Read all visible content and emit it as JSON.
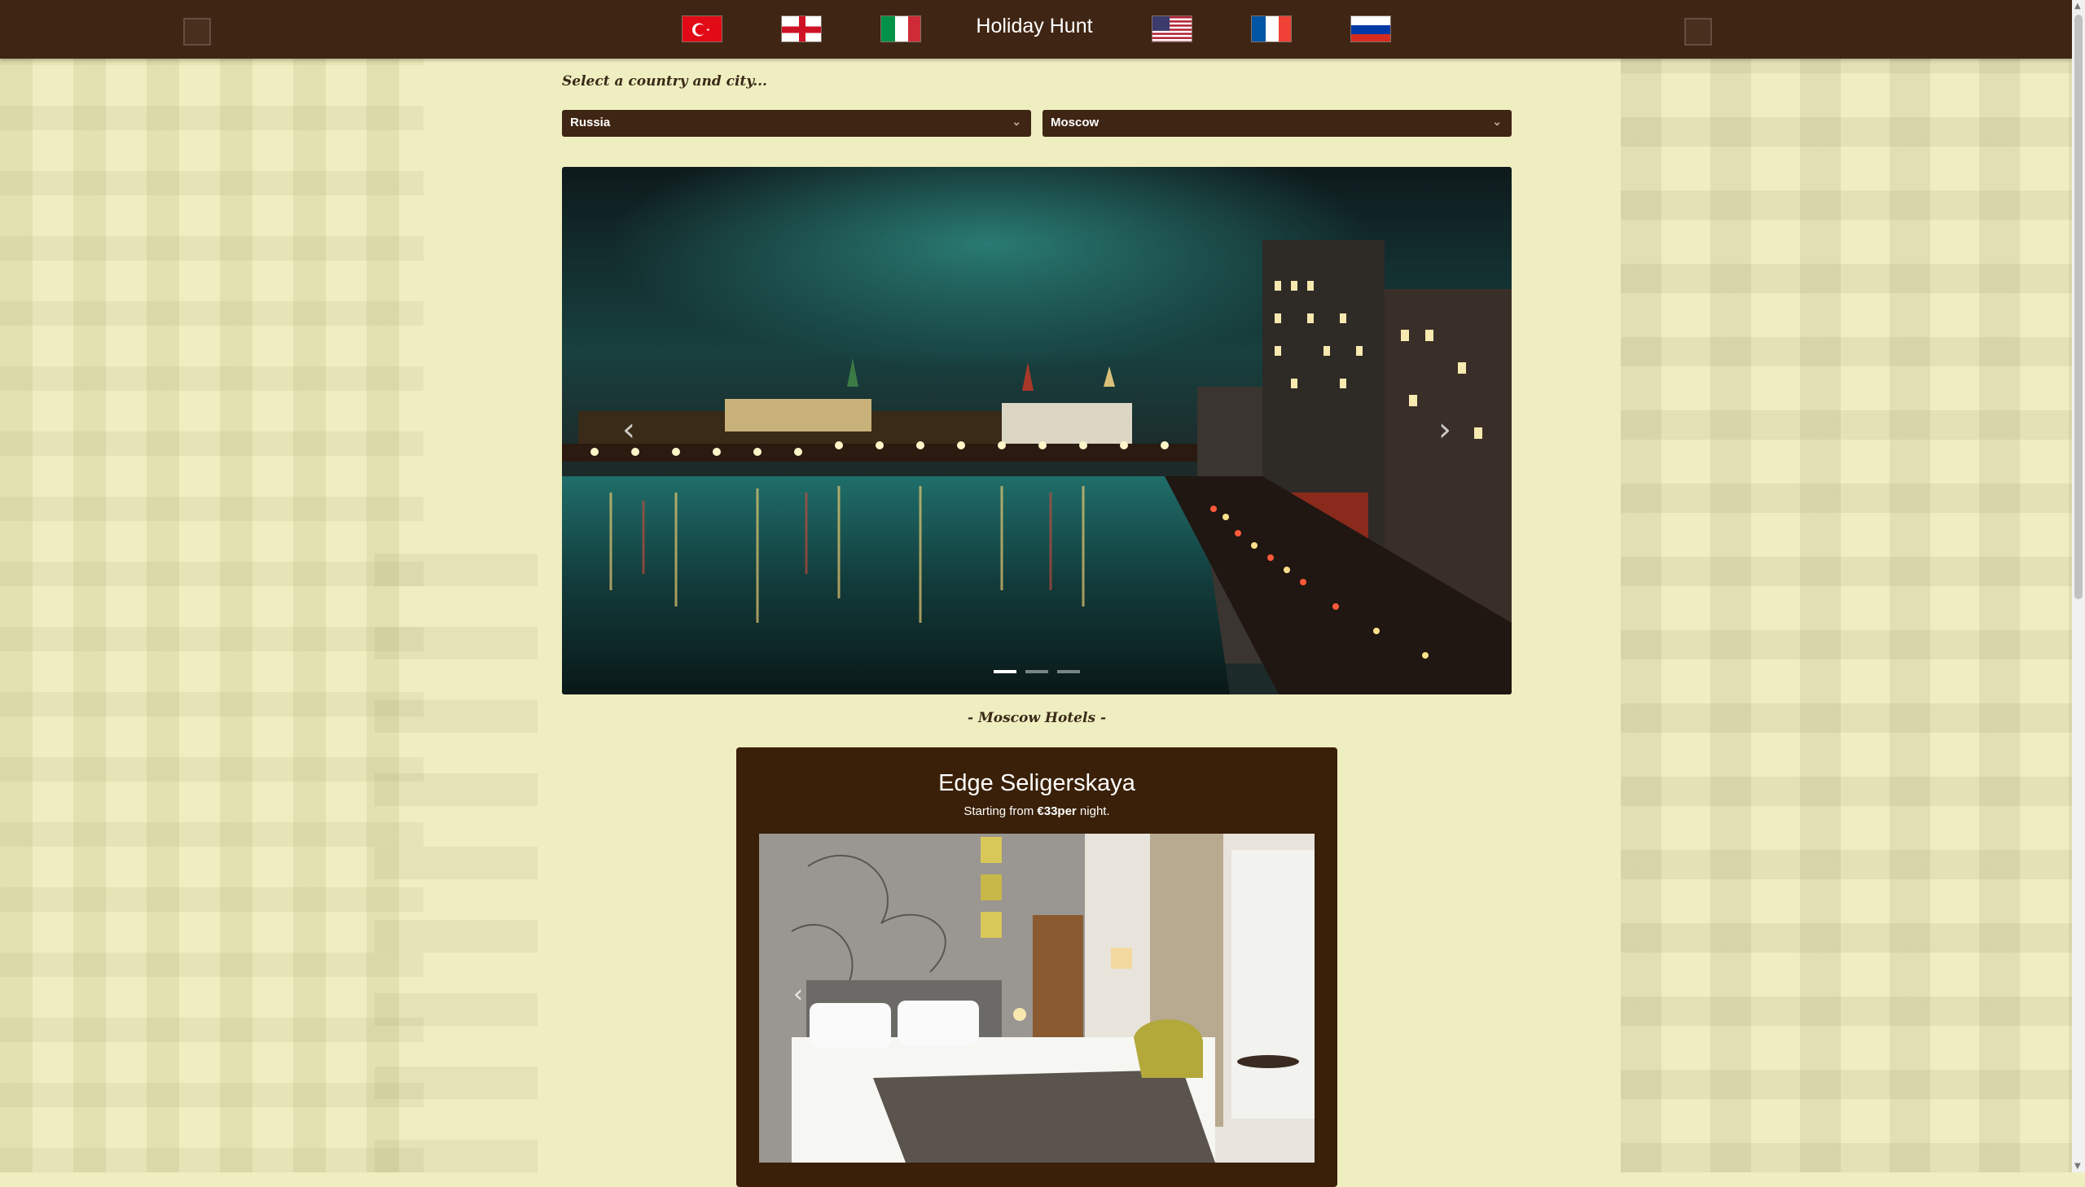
{
  "navbar": {
    "brand": "Holiday Hunt",
    "flags": [
      "turkey-flag-icon",
      "england-flag-icon",
      "italy-flag-icon",
      "usa-flag-icon",
      "france-flag-icon",
      "russia-flag-icon"
    ]
  },
  "selector": {
    "prompt": "Select a country and city...",
    "country": "Russia",
    "city": "Moscow"
  },
  "hero": {
    "slides": 3,
    "active_slide": 1
  },
  "section_title": "- Moscow Hotels -",
  "hotel": {
    "name": "Edge Seligerskaya",
    "price_prefix": "Starting from ",
    "price": "€33per",
    "price_suffix": " night.",
    "photos": 3,
    "active_photo": 1
  },
  "colors": {
    "navbar": "#3f2514",
    "card": "#3a2008",
    "background": "#efeec0"
  }
}
